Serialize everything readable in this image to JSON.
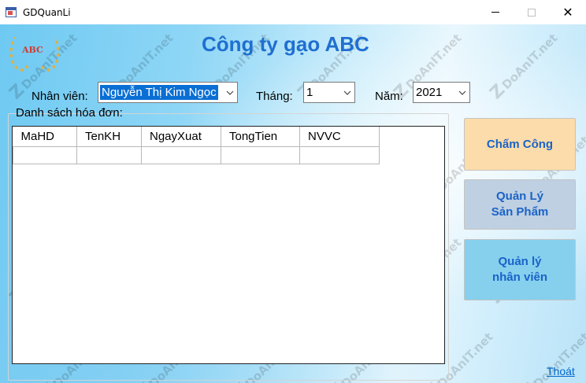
{
  "window": {
    "title": "GDQuanLi"
  },
  "header": {
    "logo_text": "ABC",
    "company_name": "Công ty gạo ABC"
  },
  "filters": {
    "employee_label": "Nhân viên:",
    "employee_value": "Nguyễn Thị Kim Ngọc",
    "month_label": "Tháng:",
    "month_value": "1",
    "year_label": "Năm:",
    "year_value": "2021"
  },
  "invoices": {
    "title": "Danh sách hóa đơn:",
    "columns": [
      "MaHD",
      "TenKH",
      "NgayXuat",
      "TongTien",
      "NVVC"
    ]
  },
  "buttons": {
    "cham_cong": "Chấm Công",
    "quan_ly_san_pham": "Quản Lý\nSản Phẩm",
    "quan_ly_nhan_vien": "Quản lý\nnhân viên",
    "thoat": "Thoát"
  },
  "watermark": {
    "text": "DoAnIT.net"
  },
  "colors": {
    "title_blue": "#1f6fd0",
    "selection_blue": "#0a6fd4",
    "btn_orange": "#fcdcaa",
    "btn_grey_blue": "#bfd0e2",
    "btn_cyan": "#86d0ee"
  }
}
